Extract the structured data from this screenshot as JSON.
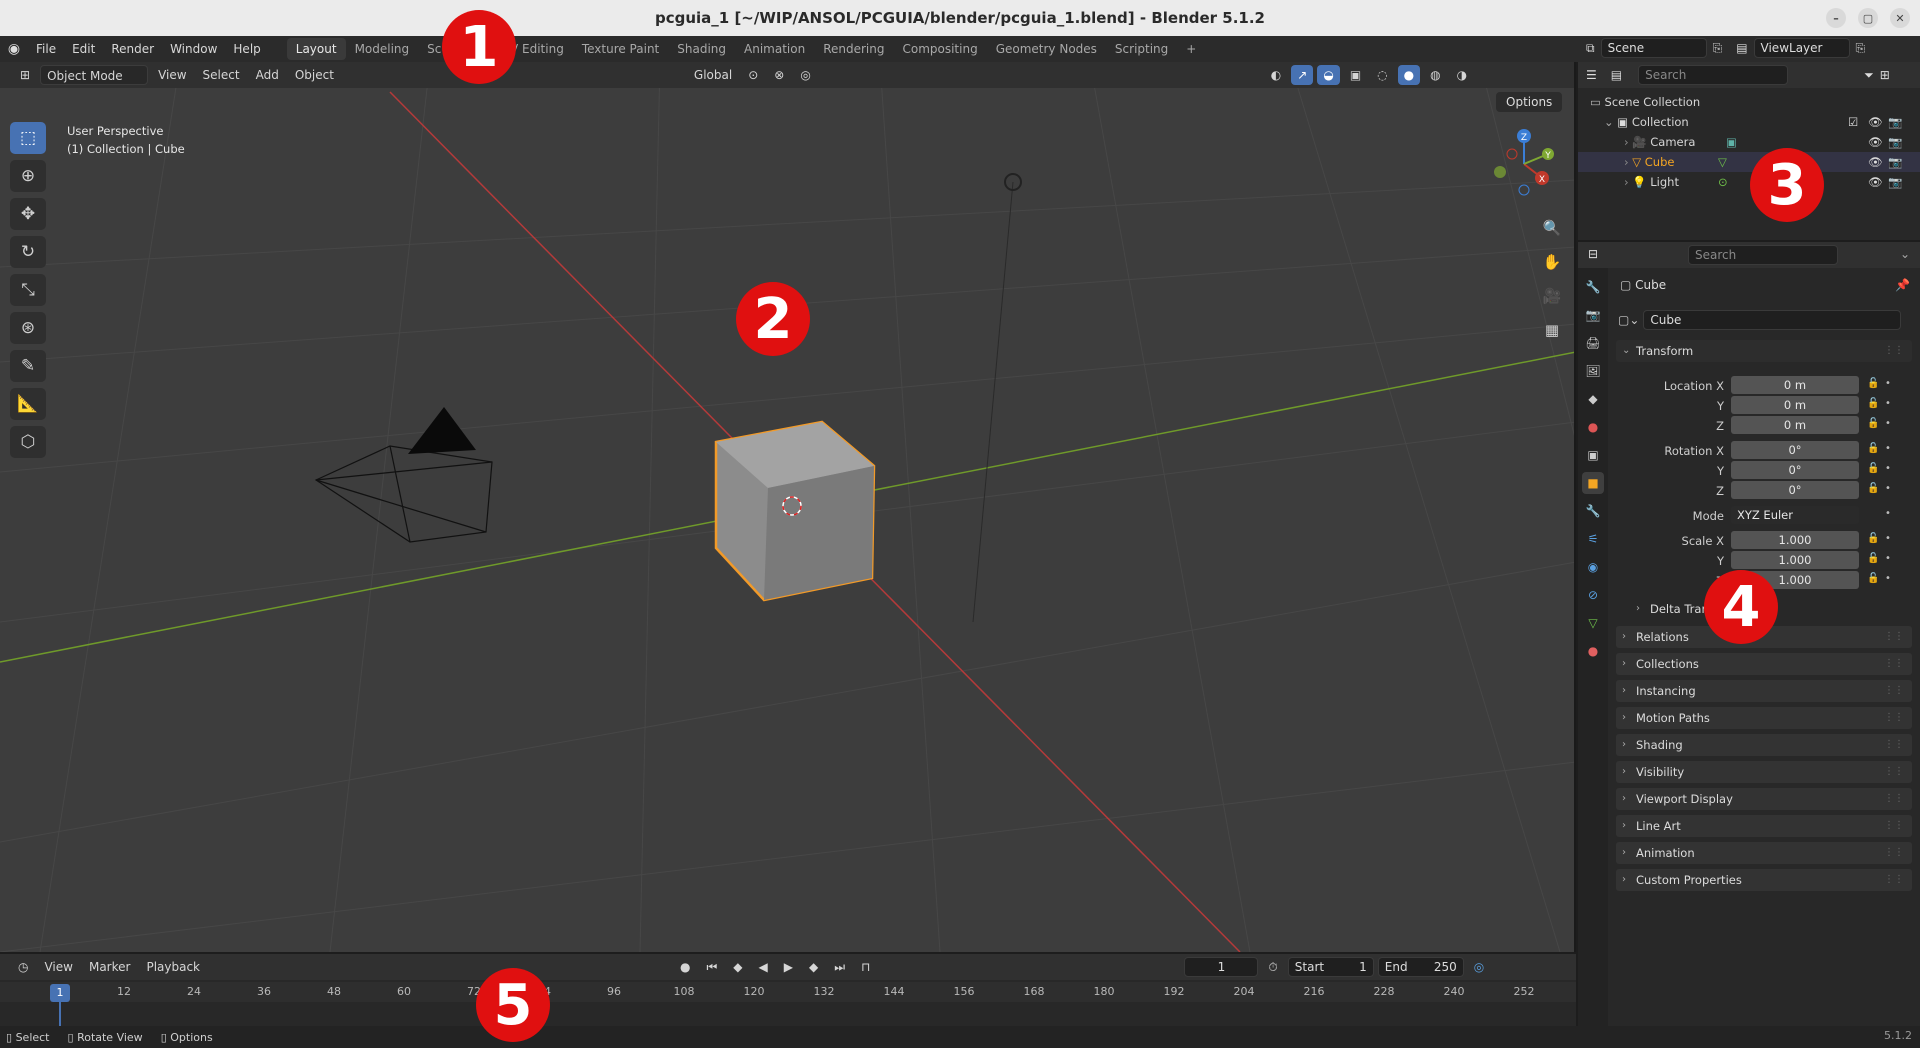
{
  "window": {
    "title": "pcguia_1 [~/WIP/ANSOL/PCGUIA/blender/pcguia_1.blend] - Blender 5.1.2"
  },
  "menu": [
    "File",
    "Edit",
    "Render",
    "Window",
    "Help"
  ],
  "workspaces": [
    {
      "label": "Layout",
      "active": true
    },
    {
      "label": "Modeling"
    },
    {
      "label": "Sculpting"
    },
    {
      "label": "UV Editing"
    },
    {
      "label": "Texture Paint"
    },
    {
      "label": "Shading"
    },
    {
      "label": "Animation"
    },
    {
      "label": "Rendering"
    },
    {
      "label": "Compositing"
    },
    {
      "label": "Geometry Nodes"
    },
    {
      "label": "Scripting"
    }
  ],
  "topright": {
    "scene": "Scene",
    "view_layer": "ViewLayer"
  },
  "viewport": {
    "mode": "Object Mode",
    "menus": [
      "View",
      "Select",
      "Add",
      "Object"
    ],
    "orientation": "Global",
    "options_label": "Options",
    "info_line1": "User Perspective",
    "info_line2": "(1) Collection | Cube",
    "gizmo": {
      "x": "X",
      "y": "Y",
      "z": "Z"
    }
  },
  "outliner": {
    "search_placeholder": "Search",
    "root": "Scene Collection",
    "collection": "Collection",
    "items": [
      {
        "name": "Camera",
        "icon": "camera-icon"
      },
      {
        "name": "Cube",
        "icon": "mesh-icon",
        "selected": true
      },
      {
        "name": "Light",
        "icon": "light-icon"
      }
    ]
  },
  "properties": {
    "search_placeholder": "Search",
    "object_name": "Cube",
    "data_name": "Cube",
    "transform_label": "Transform",
    "location": {
      "label": "Location X",
      "x": "0 m",
      "y": "0 m",
      "z": "0 m"
    },
    "rotation": {
      "label": "Rotation X",
      "x": "0°",
      "y": "0°",
      "z": "0°"
    },
    "mode_label": "Mode",
    "mode_value": "XYZ Euler",
    "scale": {
      "label": "Scale X",
      "x": "1.000",
      "y": "1.000",
      "z": "1.000"
    },
    "axis_y": "Y",
    "axis_z": "Z",
    "delta_label": "Delta Transform",
    "panels": [
      "Relations",
      "Collections",
      "Instancing",
      "Motion Paths",
      "Shading",
      "Visibility",
      "Viewport Display",
      "Line Art",
      "Animation",
      "Custom Properties"
    ]
  },
  "timeline": {
    "menus": [
      "View",
      "Marker",
      "Playback"
    ],
    "current_frame": "1",
    "start_label": "Start",
    "start": "1",
    "end_label": "End",
    "end": "250",
    "playhead": "1",
    "ticks": [
      "12",
      "24",
      "36",
      "48",
      "60",
      "72",
      "84",
      "96",
      "108",
      "120",
      "132",
      "144",
      "156",
      "168",
      "180",
      "192",
      "204",
      "216",
      "228",
      "240",
      "252"
    ]
  },
  "statusbar": {
    "select": "Select",
    "rotate": "Rotate View",
    "options": "Options",
    "version": "5.1.2"
  },
  "badges": [
    "1",
    "2",
    "3",
    "4",
    "5"
  ],
  "colors": {
    "accent": "#4772b3",
    "selection": "#f5a623",
    "badge": "#e01010",
    "x_axis": "#c0392b",
    "y_axis": "#7fa832"
  }
}
